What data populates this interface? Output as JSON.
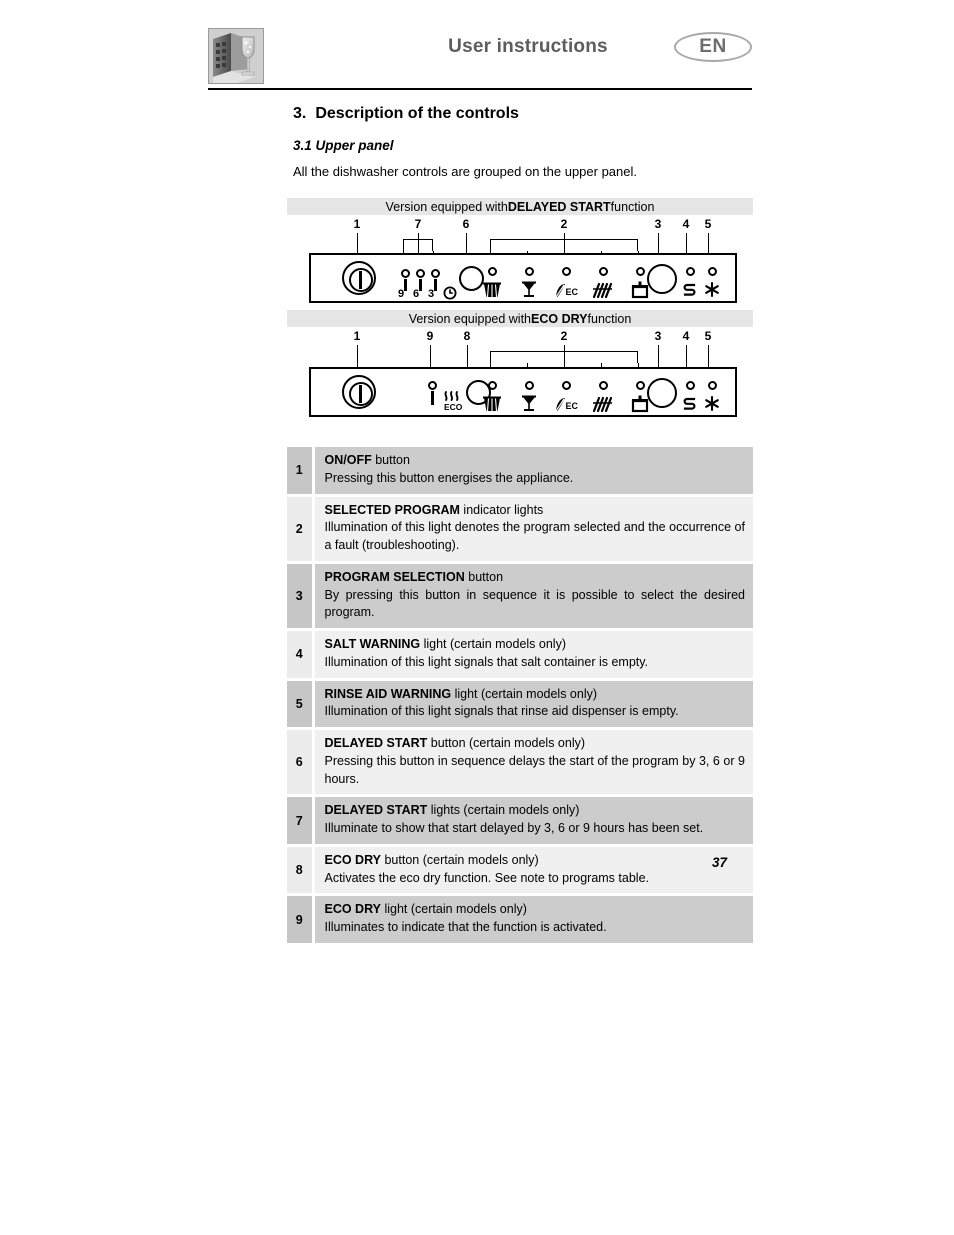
{
  "header": {
    "title": "User instructions",
    "language_badge": "EN",
    "logo_alt": "dishwasher-and-glass-logo"
  },
  "section": {
    "number": "3.",
    "title": "Description of the controls",
    "subsection": "3.1 Upper panel",
    "intro": "All the dishwasher controls are grouped on the upper panel."
  },
  "panels": [
    {
      "banner_prefix": "Version equipped with ",
      "banner_bold": "DELAYED START",
      "banner_suffix": " function",
      "callouts": [
        "1",
        "7",
        "6",
        "2",
        "3",
        "4",
        "5"
      ],
      "delay_led_labels": [
        "9",
        "6",
        "3"
      ],
      "clock_icon": "clock-icon",
      "program_icons": [
        "plates-basket-icon",
        "glasses-icon",
        "eco-icon",
        "cutlery-icon",
        "pots-pans-icon"
      ],
      "status_icons": [
        "salt-icon",
        "rinse-aid-icon"
      ]
    },
    {
      "banner_prefix": "Version equipped with ",
      "banner_bold": "ECO DRY",
      "banner_suffix": " function",
      "callouts": [
        "1",
        "9",
        "8",
        "2",
        "3",
        "4",
        "5"
      ],
      "eco_dry_label": "ECO",
      "eco_dry_icon": "eco-dry-steam-icon",
      "program_icons": [
        "plates-basket-icon",
        "glasses-icon",
        "eco-icon",
        "cutlery-icon",
        "pots-pans-icon"
      ],
      "status_icons": [
        "salt-icon",
        "rinse-aid-icon"
      ]
    }
  ],
  "table": {
    "rows": [
      {
        "num": "1",
        "title": "ON/OFF",
        "title_rest": " button",
        "desc": "Pressing this button energises the appliance."
      },
      {
        "num": "2",
        "title": "SELECTED PROGRAM",
        "title_rest": " indicator lights",
        "desc": "Illumination of this light denotes the program selected and the occurrence of a fault (troubleshooting)."
      },
      {
        "num": "3",
        "title": "PROGRAM SELECTION",
        "title_rest": " button",
        "desc": "By pressing this button in sequence it is possible to select the desired program."
      },
      {
        "num": "4",
        "title": "SALT WARNING",
        "title_rest": " light (certain models only)",
        "desc": "Illumination of this light signals that salt container is empty."
      },
      {
        "num": "5",
        "title": "RINSE AID WARNING",
        "title_rest": " light (certain models only)",
        "desc": "Illumination of this light signals that rinse aid dispenser is empty."
      },
      {
        "num": "6",
        "title": "DELAYED START",
        "title_rest": " button (certain models only)",
        "desc": "Pressing this button in sequence delays the start of the program by 3, 6 or 9 hours."
      },
      {
        "num": "7",
        "title": "DELAYED START",
        "title_rest": " lights (certain models only)",
        "desc": "Illuminate to show that start delayed by 3, 6 or 9 hours has been set."
      },
      {
        "num": "8",
        "title": "ECO DRY",
        "title_rest": " button (certain models only)",
        "desc": "Activates the eco dry function. See note to programs table."
      },
      {
        "num": "9",
        "title": "ECO DRY",
        "title_rest": " light (certain models only)",
        "desc": "Illuminates to indicate that the function is activated."
      }
    ]
  },
  "footer": {
    "page_number": "37"
  }
}
